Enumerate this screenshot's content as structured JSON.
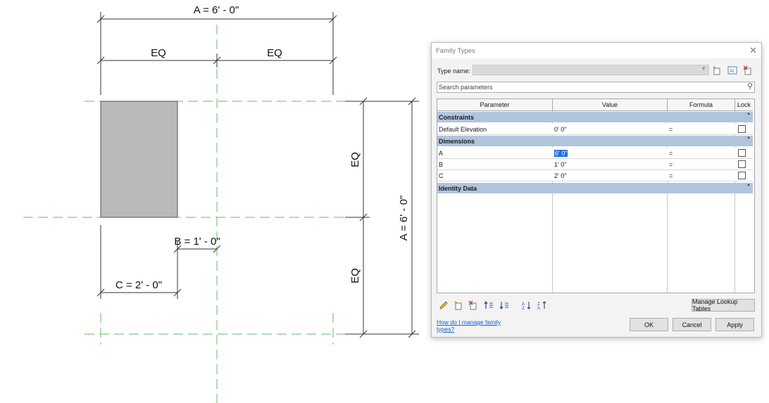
{
  "drawing": {
    "dim_a_top": "A = 6' - 0\"",
    "eq_left": "EQ",
    "eq_right": "EQ",
    "eq_upper_vertical": "EQ",
    "eq_lower_vertical": "EQ",
    "dim_a_vertical": "A = 6' - 0\"",
    "dim_b": "B = 1' - 0\"",
    "dim_c": "C = 2' - 0\""
  },
  "dialog": {
    "title": "Family Types",
    "type_name_label": "Type name:",
    "type_name_value": "",
    "search_placeholder": "Search parameters",
    "columns": {
      "parameter": "Parameter",
      "value": "Value",
      "formula": "Formula",
      "lock": "Lock"
    },
    "groups": [
      {
        "name": "Constraints",
        "rows": [
          {
            "parameter": "Default Elevation",
            "value": "0'  0\"",
            "formula": "=",
            "locked": false
          }
        ]
      },
      {
        "name": "Dimensions",
        "rows": [
          {
            "parameter": "A",
            "value": "6'  0\"",
            "formula": "=",
            "locked": false,
            "selected": true
          },
          {
            "parameter": "B",
            "value": "1'  0\"",
            "formula": "=",
            "locked": false
          },
          {
            "parameter": "C",
            "value": "2'  0\"",
            "formula": "=",
            "locked": false
          }
        ]
      },
      {
        "name": "Identity Data",
        "rows": []
      }
    ],
    "manage_lookup_label": "Manage Lookup Tables",
    "help_link": "How do I manage family types?",
    "ok_label": "OK",
    "cancel_label": "Cancel",
    "apply_label": "Apply"
  },
  "icons": {
    "new_type": "new-type-icon",
    "rename_type": "rename-type-icon",
    "delete_type": "delete-type-icon",
    "search": "search-icon",
    "edit_parameter": "pencil-icon",
    "new_parameter": "new-parameter-icon",
    "delete_parameter": "delete-parameter-icon",
    "move_up": "move-up-icon",
    "move_down": "move-down-icon",
    "sort_ascending": "sort-ascending-icon",
    "sort_descending": "sort-descending-icon"
  },
  "colors": {
    "ref_plane": "#5fbf5f",
    "group_header": "#b0c4de",
    "selection": "#1e6fd9",
    "link": "#0b5fd0"
  }
}
